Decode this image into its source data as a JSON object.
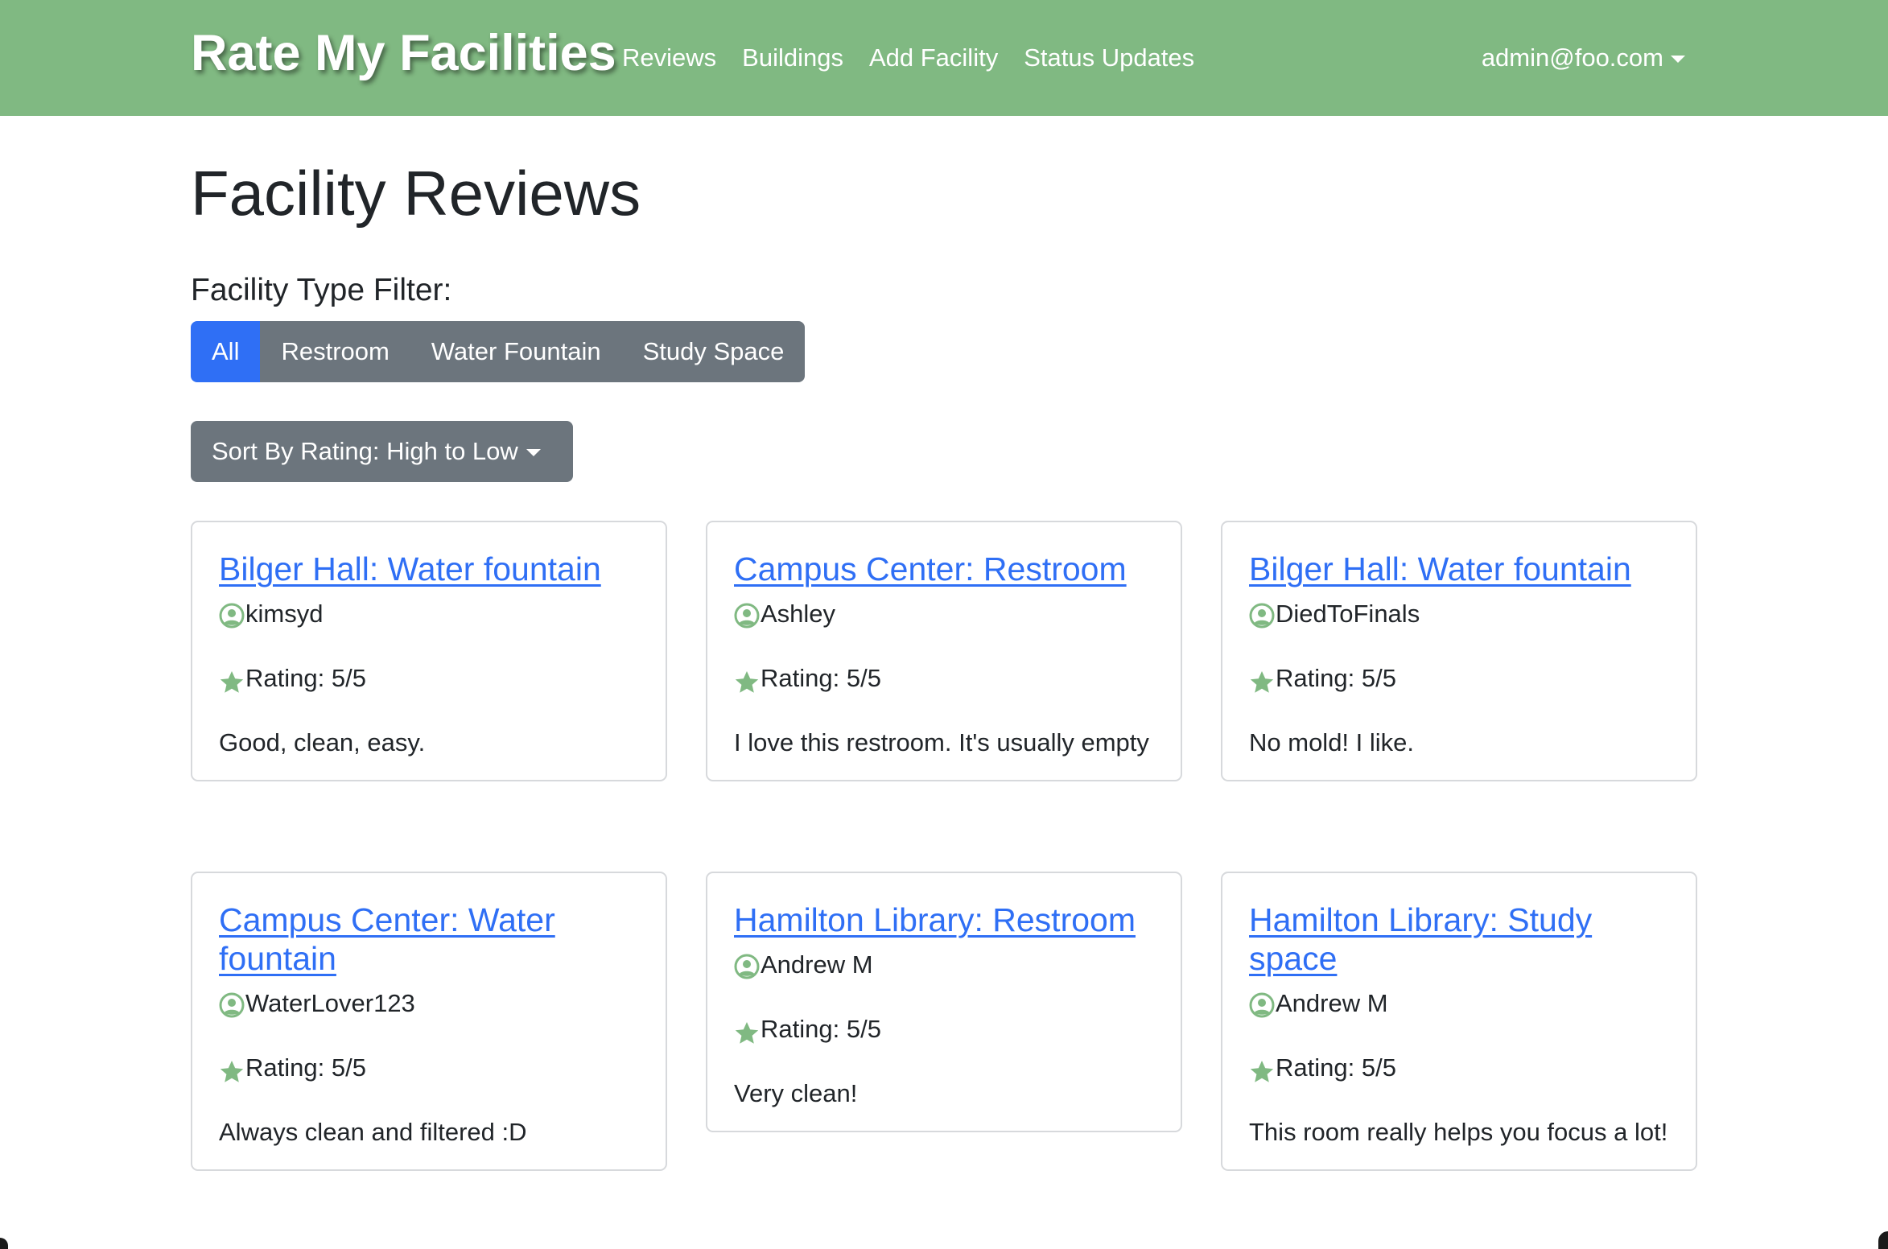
{
  "brand": "Rate My Facilities",
  "nav": {
    "links": [
      "Reviews",
      "Buildings",
      "Add Facility",
      "Status Updates"
    ],
    "user": "admin@foo.com"
  },
  "page_title": "Facility Reviews",
  "filter": {
    "label": "Facility Type Filter:",
    "options": [
      "All",
      "Restroom",
      "Water Fountain",
      "Study Space"
    ],
    "selected": "All"
  },
  "sort": {
    "label": "Sort By Rating: High to Low"
  },
  "icons": {
    "user": "person-circle-icon",
    "rating": "star-icon",
    "accent_color": "#80b982"
  },
  "reviews": [
    {
      "title": "Bilger Hall: Water fountain",
      "user": "kimsyd",
      "rating": "Rating: 5/5",
      "comment": "Good, clean, easy."
    },
    {
      "title": "Campus Center: Restroom",
      "user": "Ashley",
      "rating": "Rating: 5/5",
      "comment": "I love this restroom. It's usually empty"
    },
    {
      "title": "Bilger Hall: Water fountain",
      "user": "DiedToFinals",
      "rating": "Rating: 5/5",
      "comment": "No mold! I like."
    },
    {
      "title": "Campus Center: Water fountain",
      "user": "WaterLover123",
      "rating": "Rating: 5/5",
      "comment": "Always clean and filtered :D"
    },
    {
      "title": "Hamilton Library: Restroom",
      "user": "Andrew M",
      "rating": "Rating: 5/5",
      "comment": "Very clean!"
    },
    {
      "title": "Hamilton Library: Study space",
      "user": "Andrew M",
      "rating": "Rating: 5/5",
      "comment": "This room really helps you focus a lot!"
    }
  ]
}
